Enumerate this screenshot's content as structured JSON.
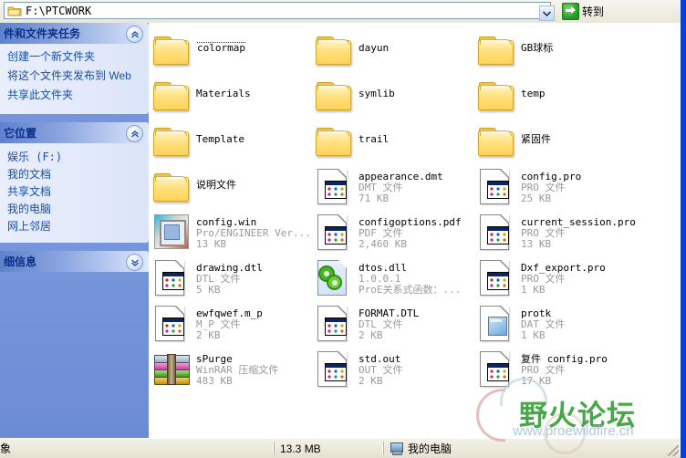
{
  "window": {
    "address_value": "F:\\PTCWORK",
    "go_label": "转到"
  },
  "sidebar": {
    "panels": [
      {
        "title": "件和文件夹任务",
        "collapse_icon": "chevron-up-icon",
        "items": [
          "创建一个新文件夹",
          "将这个文件夹发布到 Web",
          "共享此文件夹"
        ]
      },
      {
        "title": "它位置",
        "collapse_icon": "chevron-up-icon",
        "items": [
          "娱乐 (F:)",
          "我的文档",
          "共享文档",
          "我的电脑",
          "网上邻居"
        ]
      },
      {
        "title": "细信息",
        "collapse_icon": "chevron-down-icon",
        "items": []
      }
    ]
  },
  "files": [
    {
      "name": "colormap",
      "type": "folder",
      "icon": "folder-icon",
      "focused": true,
      "kind": "",
      "size": ""
    },
    {
      "name": "dayun",
      "type": "folder",
      "icon": "folder-icon",
      "focused": false,
      "kind": "",
      "size": ""
    },
    {
      "name": "GB球标",
      "type": "folder",
      "icon": "folder-icon",
      "focused": false,
      "kind": "",
      "size": ""
    },
    {
      "name": "Materials",
      "type": "folder",
      "icon": "folder-icon",
      "focused": false,
      "kind": "",
      "size": ""
    },
    {
      "name": "symlib",
      "type": "folder",
      "icon": "folder-icon",
      "focused": false,
      "kind": "",
      "size": ""
    },
    {
      "name": "temp",
      "type": "folder",
      "icon": "folder-icon",
      "focused": false,
      "kind": "",
      "size": ""
    },
    {
      "name": "Template",
      "type": "folder",
      "icon": "folder-icon",
      "focused": false,
      "kind": "",
      "size": ""
    },
    {
      "name": "trail",
      "type": "folder",
      "icon": "folder-icon",
      "focused": false,
      "kind": "",
      "size": ""
    },
    {
      "name": "紧固件",
      "type": "folder",
      "icon": "folder-icon",
      "focused": false,
      "kind": "",
      "size": ""
    },
    {
      "name": "说明文件",
      "type": "folder",
      "icon": "folder-icon",
      "focused": false,
      "kind": "",
      "size": ""
    },
    {
      "name": "appearance.dmt",
      "type": "file",
      "icon": "config-file-icon",
      "focused": false,
      "kind": "DMT 文件",
      "size": "71 KB"
    },
    {
      "name": "config.pro",
      "type": "file",
      "icon": "config-file-icon",
      "focused": false,
      "kind": "PRO 文件",
      "size": "25 KB"
    },
    {
      "name": "config.win",
      "type": "file",
      "icon": "proe-window-config-icon",
      "focused": false,
      "kind": "Pro/ENGINEER Ver...",
      "size": "13 KB"
    },
    {
      "name": "configoptions.pdf",
      "type": "file",
      "icon": "config-file-icon",
      "focused": false,
      "kind": "PDF 文件",
      "size": "2,460 KB"
    },
    {
      "name": "current_session.pro",
      "type": "file",
      "icon": "config-file-icon",
      "focused": false,
      "kind": "PRO 文件",
      "size": "13 KB"
    },
    {
      "name": "drawing.dtl",
      "type": "file",
      "icon": "config-file-icon",
      "focused": false,
      "kind": "DTL 文件",
      "size": "5 KB"
    },
    {
      "name": "dtos.dll",
      "type": "file",
      "icon": "dll-gears-icon",
      "focused": false,
      "kind": "1.0.0.1",
      "size": "ProE关系式函数：..."
    },
    {
      "name": "Dxf_export.pro",
      "type": "file",
      "icon": "config-file-icon",
      "focused": false,
      "kind": "PRO 文件",
      "size": "1 KB"
    },
    {
      "name": "ewfqwef.m_p",
      "type": "file",
      "icon": "config-file-icon",
      "focused": false,
      "kind": "M_P 文件",
      "size": "2 KB"
    },
    {
      "name": "FORMAT.DTL",
      "type": "file",
      "icon": "config-file-icon",
      "focused": false,
      "kind": "DTL 文件",
      "size": "2 KB"
    },
    {
      "name": "protk",
      "type": "file",
      "icon": "dat-file-icon",
      "focused": false,
      "kind": "DAT 文件",
      "size": "1 KB"
    },
    {
      "name": "sPurge",
      "type": "file",
      "icon": "winrar-archive-icon",
      "focused": false,
      "kind": "WinRAR 压缩文件",
      "size": "483 KB"
    },
    {
      "name": "std.out",
      "type": "file",
      "icon": "config-file-icon",
      "focused": false,
      "kind": "OUT 文件",
      "size": "2 KB"
    },
    {
      "name": "复件 config.pro",
      "type": "file",
      "icon": "config-file-icon",
      "focused": false,
      "kind": "PRO 文件",
      "size": "17 KB"
    }
  ],
  "statusbar": {
    "object_count": "象",
    "size_total": "13.3 MB",
    "location": "我的电脑"
  },
  "watermark": {
    "title": "野火论坛",
    "url": "www.proewildfire.cn"
  }
}
